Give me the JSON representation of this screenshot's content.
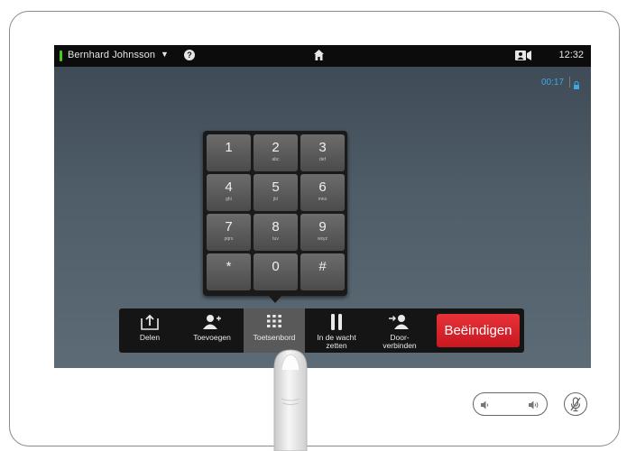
{
  "header": {
    "caller_name": "Bernhard Johnsson",
    "clock": "12:32"
  },
  "call": {
    "duration": "00:17"
  },
  "keypad": {
    "keys": [
      {
        "digit": "1",
        "letters": ""
      },
      {
        "digit": "2",
        "letters": "abc"
      },
      {
        "digit": "3",
        "letters": "def"
      },
      {
        "digit": "4",
        "letters": "ghi"
      },
      {
        "digit": "5",
        "letters": "jkl"
      },
      {
        "digit": "6",
        "letters": "mno"
      },
      {
        "digit": "7",
        "letters": "pqrs"
      },
      {
        "digit": "8",
        "letters": "tuv"
      },
      {
        "digit": "9",
        "letters": "wxyz"
      },
      {
        "digit": "*",
        "letters": ""
      },
      {
        "digit": "0",
        "letters": ""
      },
      {
        "digit": "#",
        "letters": ""
      }
    ]
  },
  "callbar": {
    "share": "Delen",
    "add": "Toevoegen",
    "keypad": "Toetsenbord",
    "hold_line1": "In de wacht",
    "hold_line2": "zetten",
    "transfer_line1": "Door-",
    "transfer_line2": "verbinden",
    "end": "Beëindigen"
  },
  "colors": {
    "presence": "#49c91e",
    "end_call": "#d9222a",
    "timer": "#3ea7e6"
  }
}
